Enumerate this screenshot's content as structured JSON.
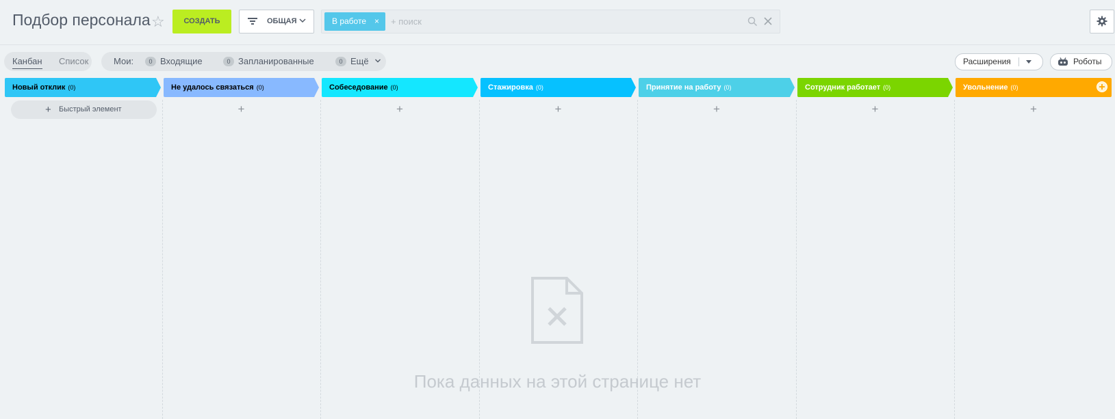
{
  "header": {
    "title": "Подбор персонала",
    "create_label": "СОЗДАТЬ",
    "filter_label": "ОБЩАЯ",
    "search": {
      "chip_label": "В работе",
      "chip_close": "×",
      "placeholder": "+ поиск",
      "clear": "✕"
    }
  },
  "toolbar": {
    "views": {
      "kanban": "Канбан",
      "list": "Список"
    },
    "counters": {
      "my_label": "Мои:",
      "items": [
        {
          "count": "0",
          "label": "Входящие"
        },
        {
          "count": "0",
          "label": "Запланированные"
        },
        {
          "count": "0",
          "label": "Ещё"
        }
      ]
    },
    "extensions_label": "Расширения",
    "robots_label": "Роботы"
  },
  "columns": [
    {
      "name": "Новый отклик",
      "count": "(0)",
      "color": "#2fc6f6",
      "text_color": "#000000"
    },
    {
      "name": "Не удалось связаться",
      "count": "(0)",
      "color": "#88b9ff",
      "text_color": "#000000"
    },
    {
      "name": "Собеседование",
      "count": "(0)",
      "color": "#14e7ff",
      "text_color": "#000000"
    },
    {
      "name": "Стажировка",
      "count": "(0)",
      "color": "#06c1ff",
      "text_color": "#ffffff"
    },
    {
      "name": "Принятие на работу",
      "count": "(0)",
      "color": "#4dd0e8",
      "text_color": "#ffffff"
    },
    {
      "name": "Сотрудник работает",
      "count": "(0)",
      "color": "#7bd500",
      "text_color": "#ffffff"
    },
    {
      "name": "Увольнение",
      "count": "(0)",
      "color": "#ffa900",
      "text_color": "#ffffff"
    }
  ],
  "quick_add_label": "Быстрый элемент",
  "add_symbol": "+",
  "empty_state": {
    "text": "Пока данных на этой странице нет"
  }
}
